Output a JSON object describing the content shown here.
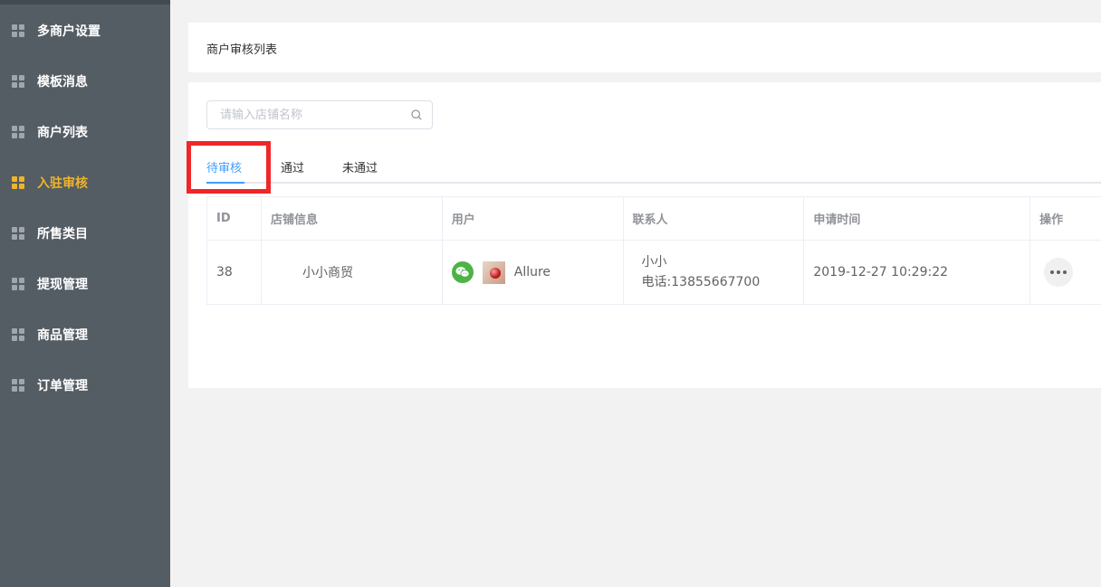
{
  "sidebar": {
    "items": [
      {
        "label": "多商户设置",
        "icon": "grid-icon",
        "active": false
      },
      {
        "label": "模板消息",
        "icon": "grid-icon",
        "active": false
      },
      {
        "label": "商户列表",
        "icon": "grid-icon",
        "active": false
      },
      {
        "label": "入驻审核",
        "icon": "grid-icon",
        "active": true
      },
      {
        "label": "所售类目",
        "icon": "grid-icon",
        "active": false
      },
      {
        "label": "提现管理",
        "icon": "grid-icon",
        "active": false
      },
      {
        "label": "商品管理",
        "icon": "grid-icon",
        "active": false
      },
      {
        "label": "订单管理",
        "icon": "grid-icon",
        "active": false
      }
    ],
    "active_color": "#f0b429"
  },
  "header": {
    "title": "商户审核列表"
  },
  "search": {
    "placeholder": "请输入店铺名称",
    "value": "",
    "icon": "search-icon"
  },
  "tabs": [
    {
      "label": "待审核",
      "active": true
    },
    {
      "label": "通过",
      "active": false
    },
    {
      "label": "未通过",
      "active": false
    }
  ],
  "table": {
    "columns": [
      "ID",
      "店铺信息",
      "用户",
      "联系人",
      "申请时间",
      "操作"
    ],
    "rows": [
      {
        "id": "38",
        "shop": "小小商贸",
        "user": {
          "platform_icon": "wechat-icon",
          "avatar": "avatar",
          "name": "Allure"
        },
        "contact_name": "小小",
        "contact_phone": "电话:13855667700",
        "time": "2019-12-27 10:29:22",
        "action_icon": "more-icon"
      }
    ]
  },
  "colors": {
    "sidebar_bg": "#545c64",
    "tab_active": "#409eff",
    "highlight": "#f0262a",
    "wechat": "#4db346"
  }
}
